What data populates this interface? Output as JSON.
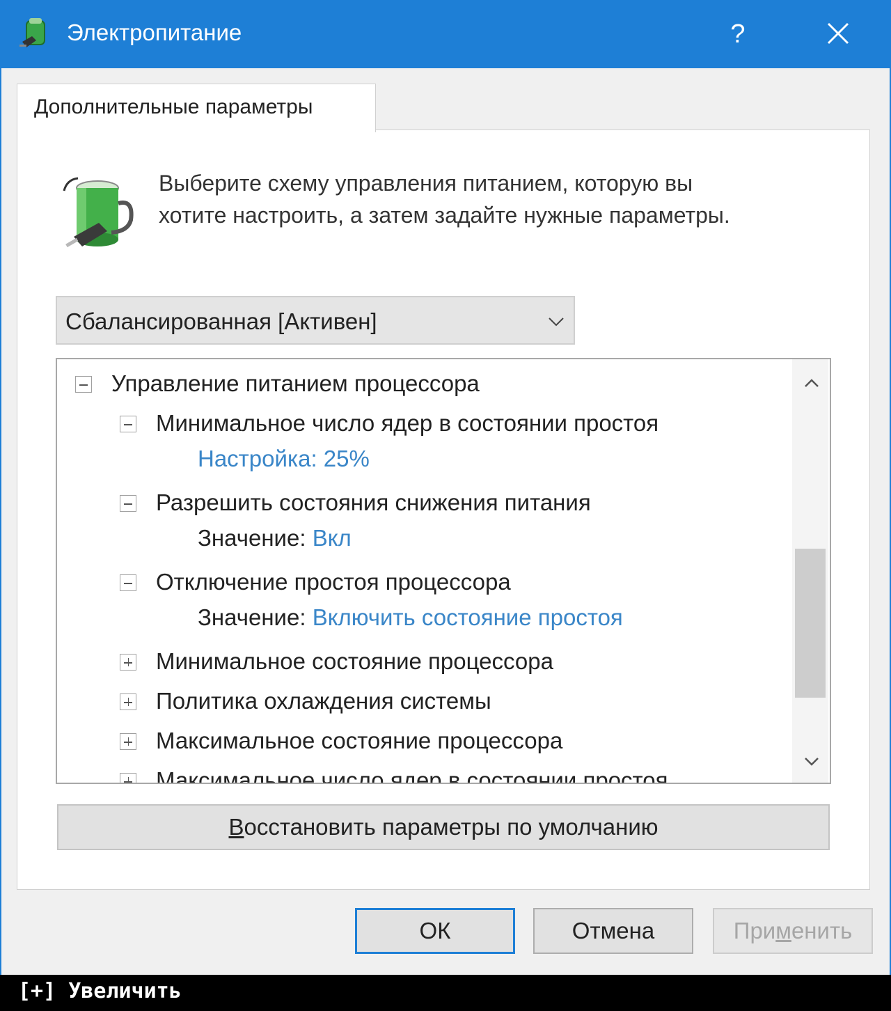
{
  "window": {
    "title": "Электропитание",
    "help_label": "?",
    "close_icon": "close-icon",
    "app_icon": "power-plug-icon",
    "accent_color": "#1e7fd6"
  },
  "tab": {
    "label": "Дополнительные параметры"
  },
  "description": {
    "line1": "Выберите схему управления питанием, которую вы",
    "line2": "хотите настроить, а затем задайте нужные параметры.",
    "icon": "battery-plug-icon"
  },
  "scheme_select": {
    "value": "Сбалансированная [Активен]",
    "icon": "chevron-down-icon"
  },
  "tree": {
    "items": [
      {
        "label": "Управление питанием процессора",
        "expanded": true
      },
      {
        "label": "Минимальное число ядер в состоянии простоя",
        "expanded": true
      },
      {
        "key": "Настройка:",
        "value": "25%"
      },
      {
        "label": "Разрешить состояния снижения питания",
        "expanded": true
      },
      {
        "key": "Значение:",
        "value": "Вкл"
      },
      {
        "label": "Отключение простоя процессора",
        "expanded": true
      },
      {
        "key": "Значение:",
        "value": "Включить состояние простоя"
      },
      {
        "label": "Минимальное состояние процессора",
        "expanded": false
      },
      {
        "label": "Политика охлаждения системы",
        "expanded": false
      },
      {
        "label": "Максимальное состояние процессора",
        "expanded": false
      },
      {
        "label": "Максимальное число ядер в состоянии простоя",
        "expanded": false
      }
    ],
    "value_color": "#3a86c8"
  },
  "restore_button": {
    "accel": "В",
    "rest": "осстановить параметры по умолчанию"
  },
  "buttons": {
    "ok": "ОК",
    "cancel": "Отмена",
    "apply_before": "При",
    "apply_accel": "м",
    "apply_after": "енить"
  },
  "overlay": {
    "enlarge": "[+] Увеличить"
  }
}
